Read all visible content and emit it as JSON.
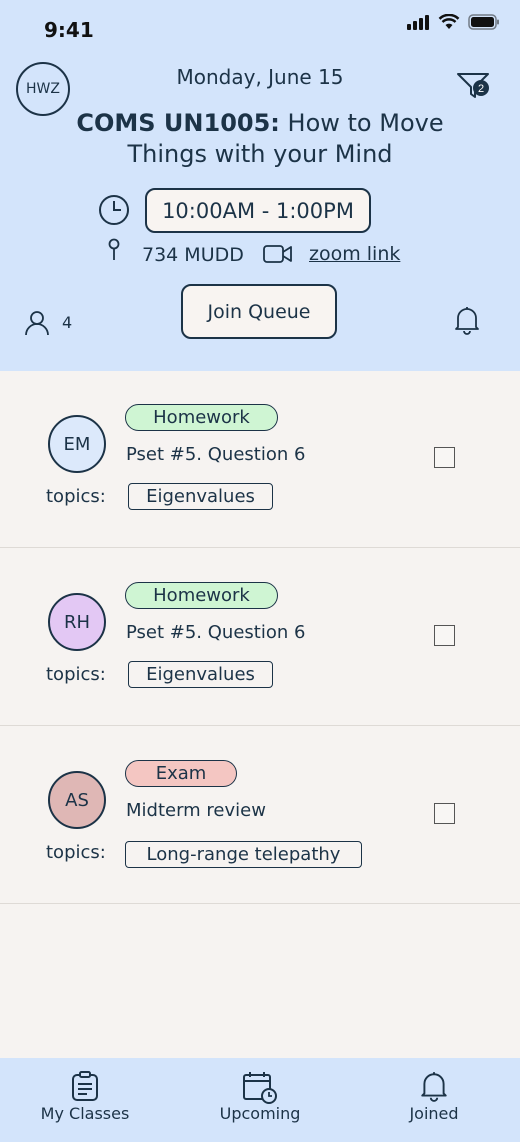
{
  "status_bar": {
    "time": "9:41"
  },
  "header": {
    "avatar_initials": "HWZ",
    "date": "Monday, June 15",
    "filter_badge": "2",
    "course_code": "COMS UN1005:",
    "course_title": "How to Move Things with your Mind",
    "time_range": "10:00AM - 1:00PM",
    "room": "734 MUDD",
    "zoom_label": "zoom link",
    "queue_count": "4",
    "join_button": "Join Queue"
  },
  "queue": [
    {
      "initials": "EM",
      "avatar_color": "#dce9fb",
      "tag": "Homework",
      "tag_type": "hw",
      "question": "Pset #5. Question 6",
      "topics_label": "topics:",
      "topic": "Eigenvalues"
    },
    {
      "initials": "RH",
      "avatar_color": "#e3c8f4",
      "tag": "Homework",
      "tag_type": "hw",
      "question": "Pset #5. Question 6",
      "topics_label": "topics:",
      "topic": "Eigenvalues"
    },
    {
      "initials": "AS",
      "avatar_color": "#dfb7b5",
      "tag": "Exam",
      "tag_type": "exam",
      "question": "Midterm review",
      "topics_label": "topics:",
      "topic": "Long-range telepathy"
    }
  ],
  "tabs": [
    {
      "label": "My Classes",
      "icon": "clipboard-icon"
    },
    {
      "label": "Upcoming",
      "icon": "calendar-clock-icon"
    },
    {
      "label": "Joined",
      "icon": "bell-icon"
    }
  ],
  "colors": {
    "header_bg": "#d3e4fb",
    "text": "#1c3347",
    "homework": "#cff5d3",
    "exam": "#f4c6c2"
  }
}
